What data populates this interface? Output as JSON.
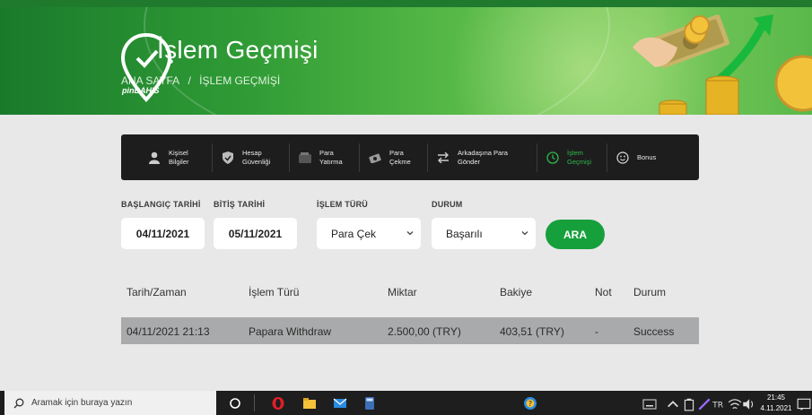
{
  "banner": {
    "title": "İşlem Geçmişi",
    "breadcrumb_home": "ANA SAYFA",
    "breadcrumb_sep": "/",
    "breadcrumb_current": "İŞLEM GEÇMİŞİ",
    "brand": "pinBAHIS"
  },
  "menu": {
    "items": [
      {
        "label": "Kişisel Bilgiler",
        "icon": "user-icon"
      },
      {
        "label": "Hesap Güvenliği",
        "icon": "shield-icon"
      },
      {
        "label": "Para Yatırma",
        "icon": "wallet-icon"
      },
      {
        "label": "Para Çekme",
        "icon": "cash-withdraw-icon"
      },
      {
        "label": "Arkadaşına Para Gönder",
        "icon": "transfer-icon"
      },
      {
        "label": "İşlem Geçmişi",
        "icon": "history-icon",
        "active": true
      },
      {
        "label": "Bonus",
        "icon": "smiley-icon"
      }
    ]
  },
  "filters": {
    "start_label": "BAŞLANGIÇ TARİHİ",
    "start_value": "04/11/2021",
    "end_label": "BİTİŞ TARİHİ",
    "end_value": "05/11/2021",
    "type_label": "İŞLEM TÜRÜ",
    "type_value": "Para Çek",
    "status_label": "DURUM",
    "status_value": "Başarılı",
    "search_button": "ARA"
  },
  "table": {
    "headers": [
      "Tarih/Zaman",
      "İşlem Türü",
      "Miktar",
      "Bakiye",
      "Not",
      "Durum"
    ],
    "rows": [
      [
        "04/11/2021 21:13",
        "Papara Withdraw",
        "2.500,00 (TRY)",
        "403,51 (TRY)",
        "-",
        "Success"
      ]
    ]
  },
  "taskbar": {
    "search_placeholder": "Aramak için buraya yazın",
    "time": "21:45",
    "date": "4.11.2021"
  },
  "colors": {
    "accent": "#16a03c",
    "menu_bg": "#1d1d1d",
    "row_bg": "#a9aaab",
    "page_bg": "#e8e8e9"
  }
}
